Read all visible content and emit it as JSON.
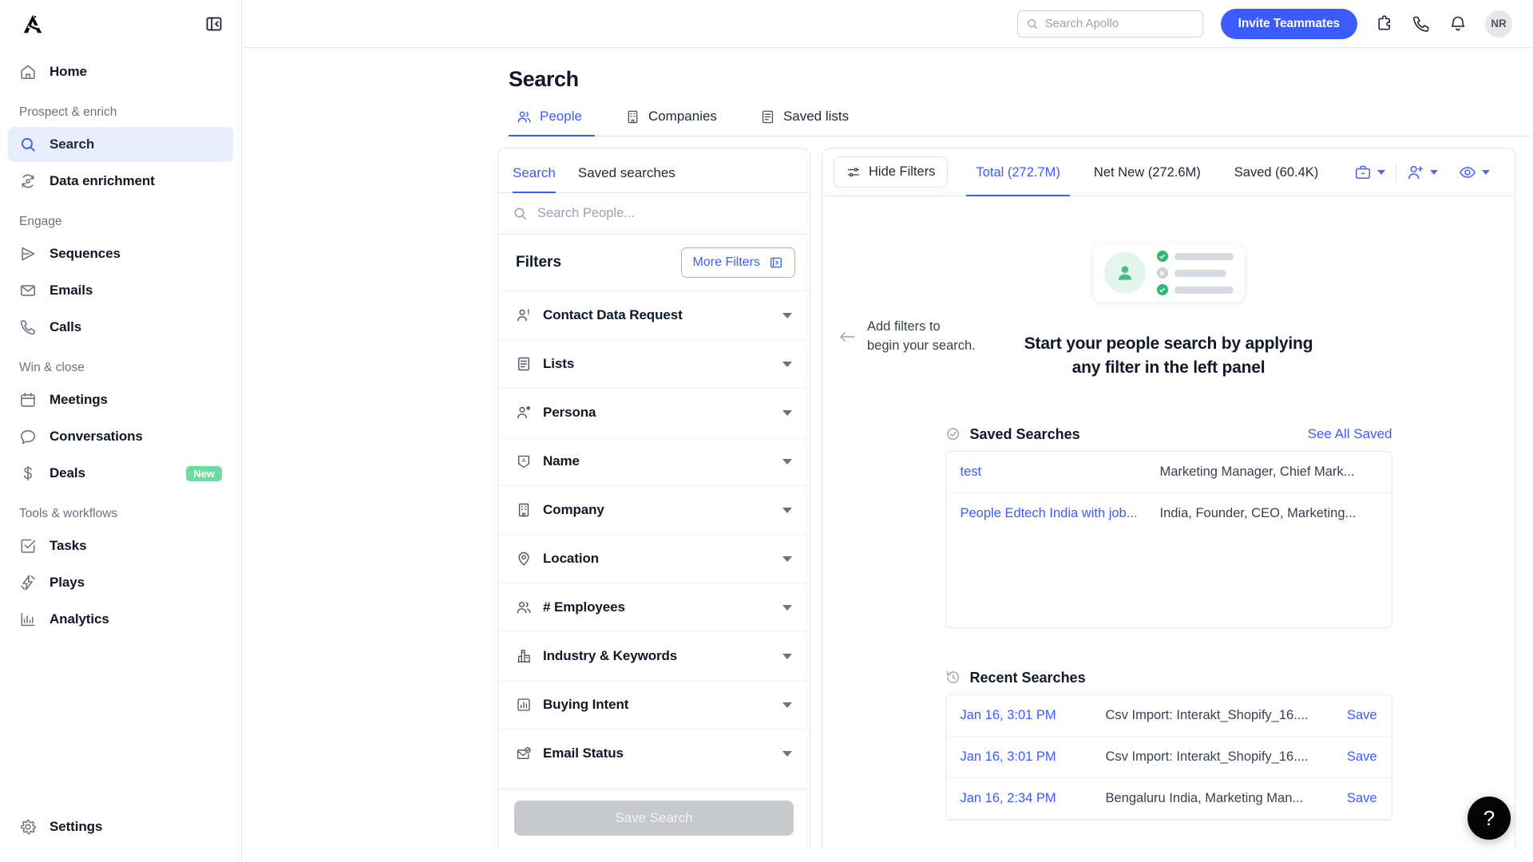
{
  "brand": {
    "accent": "#3b5bfd",
    "green": "#2eb872",
    "new_badge": "#6ddba0"
  },
  "sidebar": {
    "logo_name": "apollo-logo",
    "collapse_icon": "panel-collapse-icon",
    "home": {
      "label": "Home",
      "icon": "home-icon"
    },
    "groups": [
      {
        "label": "Prospect & enrich",
        "items": [
          {
            "label": "Search",
            "icon": "magnifier-icon",
            "active": true
          },
          {
            "label": "Data enrichment",
            "icon": "refresh-data-icon",
            "active": false
          }
        ]
      },
      {
        "label": "Engage",
        "items": [
          {
            "label": "Sequences",
            "icon": "send-icon",
            "active": false
          },
          {
            "label": "Emails",
            "icon": "envelope-icon",
            "active": false
          },
          {
            "label": "Calls",
            "icon": "phone-icon",
            "active": false
          }
        ]
      },
      {
        "label": "Win & close",
        "items": [
          {
            "label": "Meetings",
            "icon": "calendar-icon",
            "active": false
          },
          {
            "label": "Conversations",
            "icon": "chat-bubble-icon",
            "active": false
          },
          {
            "label": "Deals",
            "icon": "dollar-icon",
            "active": false,
            "badge": "New"
          }
        ]
      },
      {
        "label": "Tools & workflows",
        "items": [
          {
            "label": "Tasks",
            "icon": "checkbox-icon",
            "active": false
          },
          {
            "label": "Plays",
            "icon": "lightning-icon",
            "active": false
          },
          {
            "label": "Analytics",
            "icon": "bar-chart-icon",
            "active": false
          }
        ]
      }
    ],
    "settings": {
      "label": "Settings",
      "icon": "gear-icon"
    }
  },
  "topbar": {
    "search": {
      "placeholder": "Search Apollo",
      "value": "",
      "icon": "search-icon"
    },
    "invite_label": "Invite Teammates",
    "icons": [
      "puzzle-piece-icon",
      "phone-icon",
      "bell-icon"
    ],
    "avatar_initials": "NR"
  },
  "page": {
    "title": "Search",
    "tabs": [
      {
        "label": "People",
        "icon": "people-icon",
        "active": true
      },
      {
        "label": "Companies",
        "icon": "building-icon",
        "active": false
      },
      {
        "label": "Saved lists",
        "icon": "list-icon",
        "active": false
      }
    ]
  },
  "filter_panel": {
    "tabs": [
      {
        "label": "Search",
        "active": true
      },
      {
        "label": "Saved searches",
        "active": false
      }
    ],
    "search": {
      "placeholder": "Search People...",
      "value": "",
      "icon": "search-icon"
    },
    "filters_title": "Filters",
    "more_filters_label": "More Filters",
    "more_filters_icon": "panel-expand-icon",
    "rows": [
      {
        "label": "Contact Data Request",
        "icon": "person-alert-icon"
      },
      {
        "label": "Lists",
        "icon": "list-icon"
      },
      {
        "label": "Persona",
        "icon": "person-star-icon"
      },
      {
        "label": "Name",
        "icon": "name-tag-icon"
      },
      {
        "label": "Company",
        "icon": "building-icon"
      },
      {
        "label": "Location",
        "icon": "map-pin-icon"
      },
      {
        "label": "# Employees",
        "icon": "people-icon"
      },
      {
        "label": "Industry & Keywords",
        "icon": "factory-icon"
      },
      {
        "label": "Buying Intent",
        "icon": "bar-chart-icon"
      },
      {
        "label": "Email Status",
        "icon": "envelope-check-icon"
      }
    ],
    "save_search_label": "Save Search"
  },
  "results": {
    "hide_filters_label": "Hide Filters",
    "hide_filters_icon": "sliders-icon",
    "tabs": [
      {
        "label": "Total (272.7M)",
        "active": true
      },
      {
        "label": "Net New (272.6M)",
        "active": false
      },
      {
        "label": "Saved (60.4K)",
        "active": false
      }
    ],
    "actions": [
      {
        "icon": "briefcase-icon",
        "caret": true
      },
      {
        "icon": "add-person-icon",
        "caret": true
      },
      {
        "icon": "eye-icon",
        "caret": true
      }
    ],
    "hint_line1": "Add filters to",
    "hint_line2": "begin your search.",
    "hint_arrow_icon": "arrow-left-icon",
    "empty_title_line1": "Start your people search by applying",
    "empty_title_line2": "any filter in the left panel",
    "illustration": {
      "name": "contact-card-illustration",
      "avatar_icon": "person-icon",
      "rows": [
        {
          "status": "ok",
          "icon": "check-icon"
        },
        {
          "status": "no",
          "icon": "x-icon"
        },
        {
          "status": "ok",
          "icon": "check-icon"
        }
      ]
    },
    "saved_searches": {
      "title": "Saved Searches",
      "icon": "check-circle-icon",
      "see_all_label": "See All Saved",
      "rows": [
        {
          "name": "test",
          "desc": "Marketing Manager, Chief Mark..."
        },
        {
          "name": "People Edtech India with job...",
          "desc": "India, Founder, CEO, Marketing..."
        }
      ]
    },
    "recent_searches": {
      "title": "Recent Searches",
      "icon": "history-icon",
      "save_label": "Save",
      "rows": [
        {
          "date": "Jan 16, 3:01 PM",
          "desc": "Csv Import: Interakt_Shopify_16...."
        },
        {
          "date": "Jan 16, 3:01 PM",
          "desc": "Csv Import: Interakt_Shopify_16...."
        },
        {
          "date": "Jan 16, 2:34 PM",
          "desc": "Bengaluru India, Marketing Man..."
        }
      ]
    }
  },
  "help_fab": {
    "label": "?",
    "icon": "question-mark-icon"
  }
}
